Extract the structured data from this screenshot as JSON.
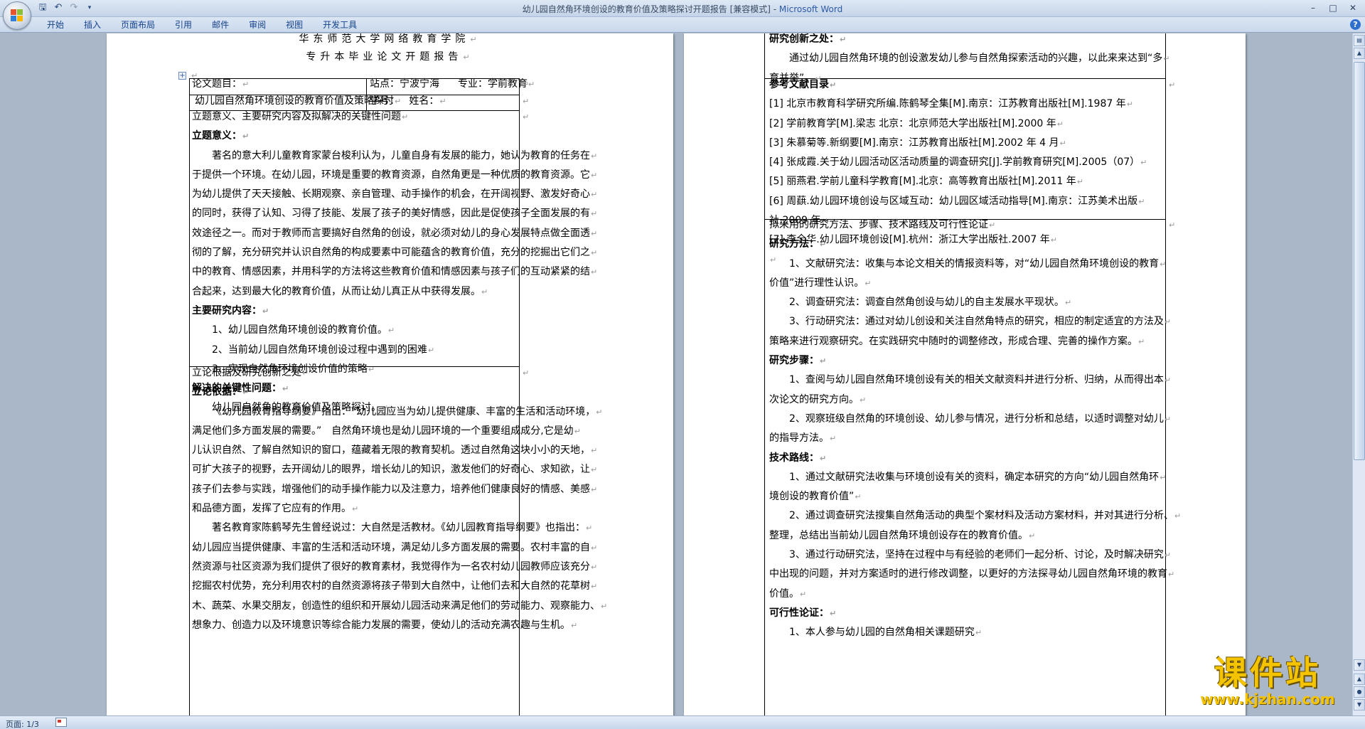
{
  "window": {
    "title": "幼儿园自然角环境创设的教育价值及策略探讨开题报告 [兼容模式] - ",
    "app_name": "Microsoft Word"
  },
  "ribbon": {
    "tabs": [
      "开始",
      "插入",
      "页面布局",
      "引用",
      "邮件",
      "审阅",
      "视图",
      "开发工具"
    ]
  },
  "page1": {
    "school": "华东师范大学网络教育学院",
    "report_title": "专升本毕业论文开题报告",
    "table": {
      "topic_label": "论文题目：",
      "topic_value": "幼儿园自然角环境创设的教育价值及策略探讨",
      "station": "站点：宁波宁海",
      "major": "专业：学前教育",
      "student_id": "学号：",
      "name": "姓名："
    },
    "section1_heading": "立题意义、主要研究内容及拟解决的关键性问题",
    "significance_heading": "立题意义：",
    "significance_lines": [
      "著名的意大利儿童教育家蒙台梭利认为，儿童自身有发展的能力，她认为教育的任务在",
      "于提供一个环境。在幼儿园，环境是重要的教育资源，自然角更是一种优质的教育资源。它",
      "为幼儿提供了天天接触、长期观察、亲自管理、动手操作的机会，在开阔视野、激发好奇心",
      "的同时，获得了认知、习得了技能、发展了孩子的美好情感，因此是促使孩子全面发展的有",
      "效途径之一。而对于教师而言要搞好自然角的创设，就必须对幼儿的身心发展特点做全面透",
      "彻的了解，充分研究并认识自然角的构成要素中可能蕴含的教育价值，充分的挖掘出它们之",
      "中的教育、情感因素，并用科学的方法将这些教育价值和情感因素与孩子们的互动紧紧的结",
      "合起来，达到最大化的教育价值，从而让幼儿真正从中获得发展。"
    ],
    "content_heading": "主要研究内容：",
    "content_items": [
      "1、幼儿园自然角环境创设的教育价值。",
      "2、当前幼儿园自然角环境创设过程中遇到的困难",
      "3、实现自然角环境创设价值的策略"
    ],
    "key_heading": "解决的关键性问题：",
    "key_line": "幼儿园自然角的教育价值及策略探讨。",
    "section2_heading": "立论根据及研究创新之处",
    "basis_heading": "立论依据：",
    "basis_lines": [
      "《幼儿园教育指导纲要》指出：“幼儿园应当为幼儿提供健康、丰富的生活和活动环境，",
      "满足他们多方面发展的需要。”　自然角环境也是幼儿园环境的一个重要组成成分,它是幼",
      "儿认识自然、了解自然知识的窗口，蕴藏着无限的教育契机。透过自然角这块小小的天地，",
      "可扩大孩子的视野，去开阔幼儿的眼界，增长幼儿的知识，激发他们的好奇心、求知欲，让",
      "孩子们去参与实践，增强他们的动手操作能力以及注意力，培养他们健康良好的情感、美感",
      "和品德方面，发挥了它应有的作用。",
      "著名教育家陈鹤琴先生曾经说过：大自然是活教材。《幼儿园教育指导纲要》也指出：",
      "幼儿园应当提供健康、丰富的生活和活动环境，满足幼儿多方面发展的需要。农村丰富的自",
      "然资源与社区资源为我们提供了很好的教育素材，我觉得作为一名农村幼儿园教师应该充分",
      "挖掘农村优势，充分利用农村的自然资源将孩子带到大自然中，让他们去和大自然的花草树",
      "木、蔬菜、水果交朋友，创造性的组织和开展幼儿园活动来满足他们的劳动能力、观察能力、",
      "想象力、创造力以及环境意识等综合能力发展的需要，使幼儿的活动充满农趣与生机。"
    ]
  },
  "page2": {
    "innovation_heading": "研究创新之处：",
    "innovation_lines": [
      "通过幼儿园自然角环境的创设激发幼儿参与自然角探索活动的兴趣，以此来来达到“多",
      "育并举”。"
    ],
    "refs_heading": "参考文献目录",
    "references": [
      "[1] 北京市教育科学研究所编.陈鹤琴全集[M].南京：江苏教育出版社[M].1987 年",
      "[2] 学前教育学[M].梁志 北京：北京师范大学出版社[M].2000 年",
      "[3] 朱慕菊等.新纲要[M].南京：江苏教育出版社[M].2002 年 4 月",
      "[4] 张成霞.关于幼儿园活动区活动质量的调查研究[J].学前教育研究[M].2005（07）",
      "[5] 丽燕君.学前儿童科学教育[M].北京：高等教育出版社[M].2011 年",
      "[6] 周蕻.幼儿园环境创设与区域互动：幼儿园区域活动指导[M].南京：江苏美术出版",
      "社.2009 年",
      "[7] 李全华.幼儿园环境创设[M].杭州：浙江大学出版社.2007 年"
    ],
    "methods_section": "拟采用的研究方法、步骤、技术路线及可行性论证",
    "methods_heading": "研究方法：",
    "methods_lines": [
      "1、文献研究法：收集与本论文相关的情报资料等，对“幼儿园自然角环境创设的教育",
      "价值”进行理性认识。",
      "2、调查研究法：调查自然角创设与幼儿的自主发展水平现状。",
      "3、行动研究法：通过对幼儿创设和关注自然角特点的研究，相应的制定适宜的方法及",
      "策略来进行观察研究。在实践研究中随时的调整修改，形成合理、完善的操作方案。"
    ],
    "steps_heading": "研究步骤：",
    "steps_lines": [
      "1、查阅与幼儿园自然角环境创设有关的相关文献资料并进行分析、归纳，从而得出本",
      "次论文的研究方向。",
      "2、观察班级自然角的环境创设、幼儿参与情况，进行分析和总结，以适时调整对幼儿",
      "的指导方法。"
    ],
    "route_heading": "技术路线：",
    "route_lines": [
      "1、通过文献研究法收集与环境创设有关的资料，确定本研究的方向“幼儿园自然角环",
      "境创设的教育价值”",
      "2、通过调查研究法搜集自然角活动的典型个案材料及活动方案材料，并对其进行分析、",
      "整理，总结出当前幼儿园自然角环境创设存在的教育价值。",
      "3、通过行动研究法，坚持在过程中与有经验的老师们一起分析、讨论，及时解决研究",
      "中出现的问题，并对方案适时的进行修改调整，以更好的方法探寻幼儿园自然角环境的教育",
      "价值。"
    ],
    "feasibility_heading": "可行性论证：",
    "feasibility_line": "1、本人参与幼儿园的自然角相关课题研究"
  },
  "status": {
    "page_info": "页面: 1/3"
  },
  "watermark": {
    "main": "课件站",
    "url": "www.kjzhan.com"
  },
  "colors": {
    "ribbon_text": "#15428b",
    "title_app": "#2d5aa6",
    "watermark": "#f5c400"
  }
}
